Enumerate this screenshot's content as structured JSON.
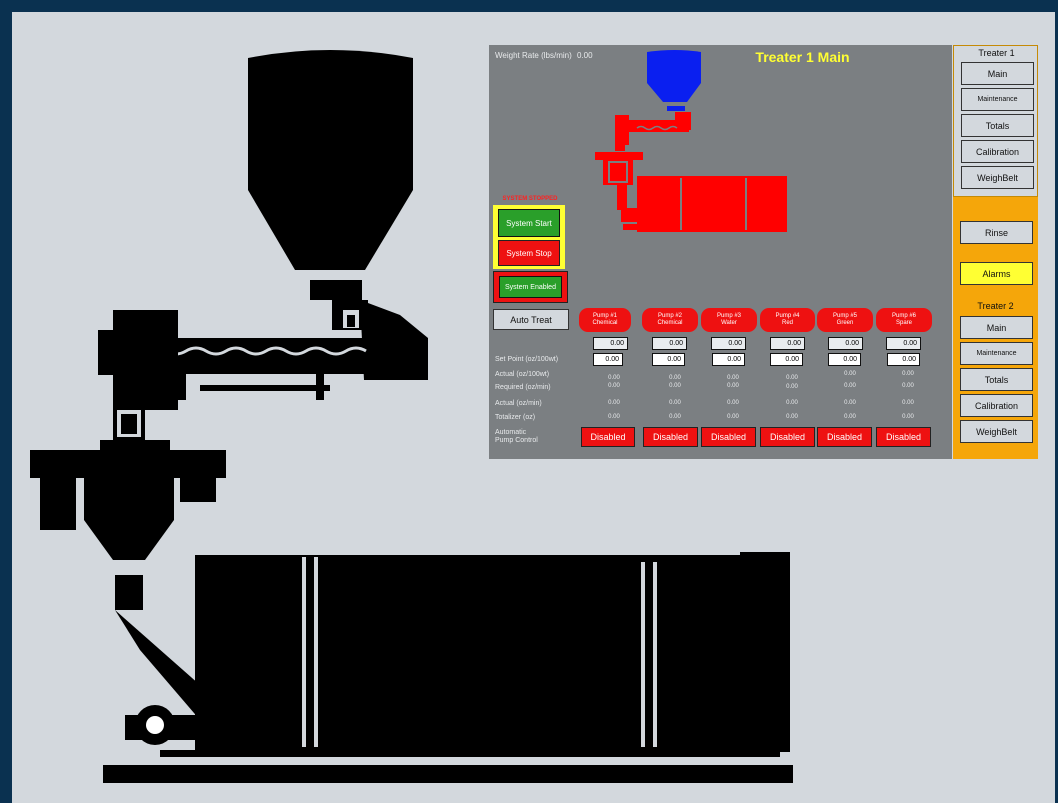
{
  "header": {
    "weight_rate_label": "Weight Rate (lbs/min)",
    "weight_rate_value": "0.00",
    "title": "Treater 1 Main"
  },
  "system": {
    "status": "SYSTEM STOPPED",
    "start_label": "System Start",
    "stop_label": "System Stop",
    "enabled_label": "System Enabled",
    "auto_treat_label": "Auto Treat"
  },
  "pumps": [
    {
      "name": "Pump #1",
      "sub": "Chemical",
      "top_value": "0.00",
      "set_point": "0.00",
      "actual_oz_100wt": "0.00",
      "required": "0.00",
      "actual_oz_min": "0.00",
      "totalizer": "0.00",
      "control": "Disabled"
    },
    {
      "name": "Pump #2",
      "sub": "Chemical",
      "top_value": "0.00",
      "set_point": "0.00",
      "actual_oz_100wt": "0.00",
      "required": "0.00",
      "actual_oz_min": "0.00",
      "totalizer": "0.00",
      "control": "Disabled"
    },
    {
      "name": "Pump #3",
      "sub": "Water",
      "top_value": "0.00",
      "set_point": "0.00",
      "actual_oz_100wt": "0.00",
      "required": "0.00",
      "actual_oz_min": "0.00",
      "totalizer": "0.00",
      "control": "Disabled"
    },
    {
      "name": "Pump #4",
      "sub": "Red",
      "top_value": "0.00",
      "set_point": "0.00",
      "actual_oz_100wt": "0.00",
      "required": "0.00",
      "actual_oz_min": "0.00",
      "totalizer": "0.00",
      "control": "Disabled"
    },
    {
      "name": "Pump #5",
      "sub": "Green",
      "top_value": "0.00",
      "set_point": "0.00",
      "actual_oz_100wt": "0.00",
      "required": "0.00",
      "actual_oz_min": "0.00",
      "totalizer": "0.00",
      "control": "Disabled"
    },
    {
      "name": "Pump #6",
      "sub": "Spare",
      "top_value": "0.00",
      "set_point": "0.00",
      "actual_oz_100wt": "0.00",
      "required": "0.00",
      "actual_oz_min": "0.00",
      "totalizer": "0.00",
      "control": "Disabled"
    }
  ],
  "row_labels": {
    "set_point": "Set Point (oz/100wt)",
    "actual_oz_100wt": "Actual (oz/100wt)",
    "required": "Required (oz/min)",
    "actual_oz_min": "Actual (oz/min)",
    "totalizer": "Totalizer (oz)",
    "auto_control_1": "Automatic",
    "auto_control_2": "Pump Control"
  },
  "nav": {
    "treater1_title": "Treater 1",
    "treater1": [
      "Main",
      "Maintenance",
      "Totals",
      "Calibration",
      "WeighBelt"
    ],
    "rinse": "Rinse",
    "alarms": "Alarms",
    "treater2_title": "Treater 2",
    "treater2": [
      "Main",
      "Maintenance",
      "Totals",
      "Calibration",
      "WeighBelt"
    ]
  },
  "colors": {
    "background": "#0a3150",
    "panel": "#7b7f82",
    "machine_red": "#ff0000",
    "hopper_blue": "#0a1ff0",
    "title_yellow": "#ffff33",
    "nav_orange": "#f5a60a"
  }
}
